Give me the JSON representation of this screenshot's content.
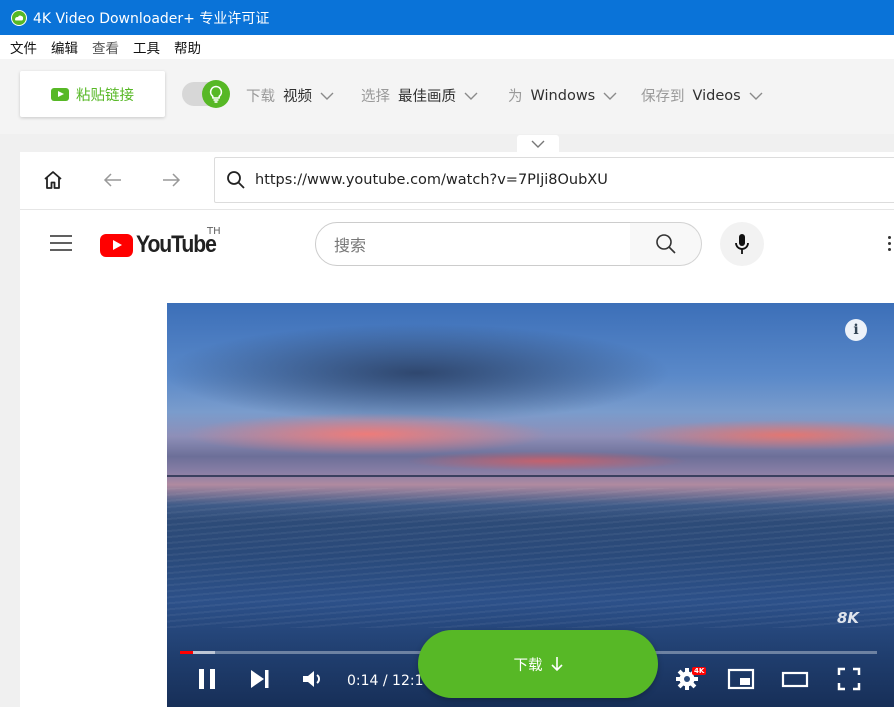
{
  "window": {
    "title": "4K Video Downloader+ 专业许可证"
  },
  "menu": [
    "文件",
    "编辑",
    "查看",
    "工具",
    "帮助"
  ],
  "toolbar": {
    "paste_label": "粘贴链接",
    "smart_mode": true,
    "download_label": "下载",
    "download_value": "视频",
    "select_label": "选择",
    "select_value": "最佳画质",
    "for_label": "为",
    "for_value": "Windows",
    "save_label": "保存到",
    "save_value": "Videos"
  },
  "browser": {
    "url": "https://www.youtube.com/watch?v=7PIji8OubXU"
  },
  "youtube": {
    "logo_text": "YouTube",
    "region": "TH",
    "search_placeholder": "搜索"
  },
  "player": {
    "time": "0:14 / 12:16",
    "quality_badge": "4K",
    "watermark": "8K",
    "info_glyph": "i",
    "progress_played": 0.019,
    "progress_buffered": 0.05
  },
  "download_button": {
    "label": "下载"
  },
  "colors": {
    "titlebar": "#0a73d8",
    "accent_green": "#57b826",
    "youtube_red": "#ff0000"
  }
}
